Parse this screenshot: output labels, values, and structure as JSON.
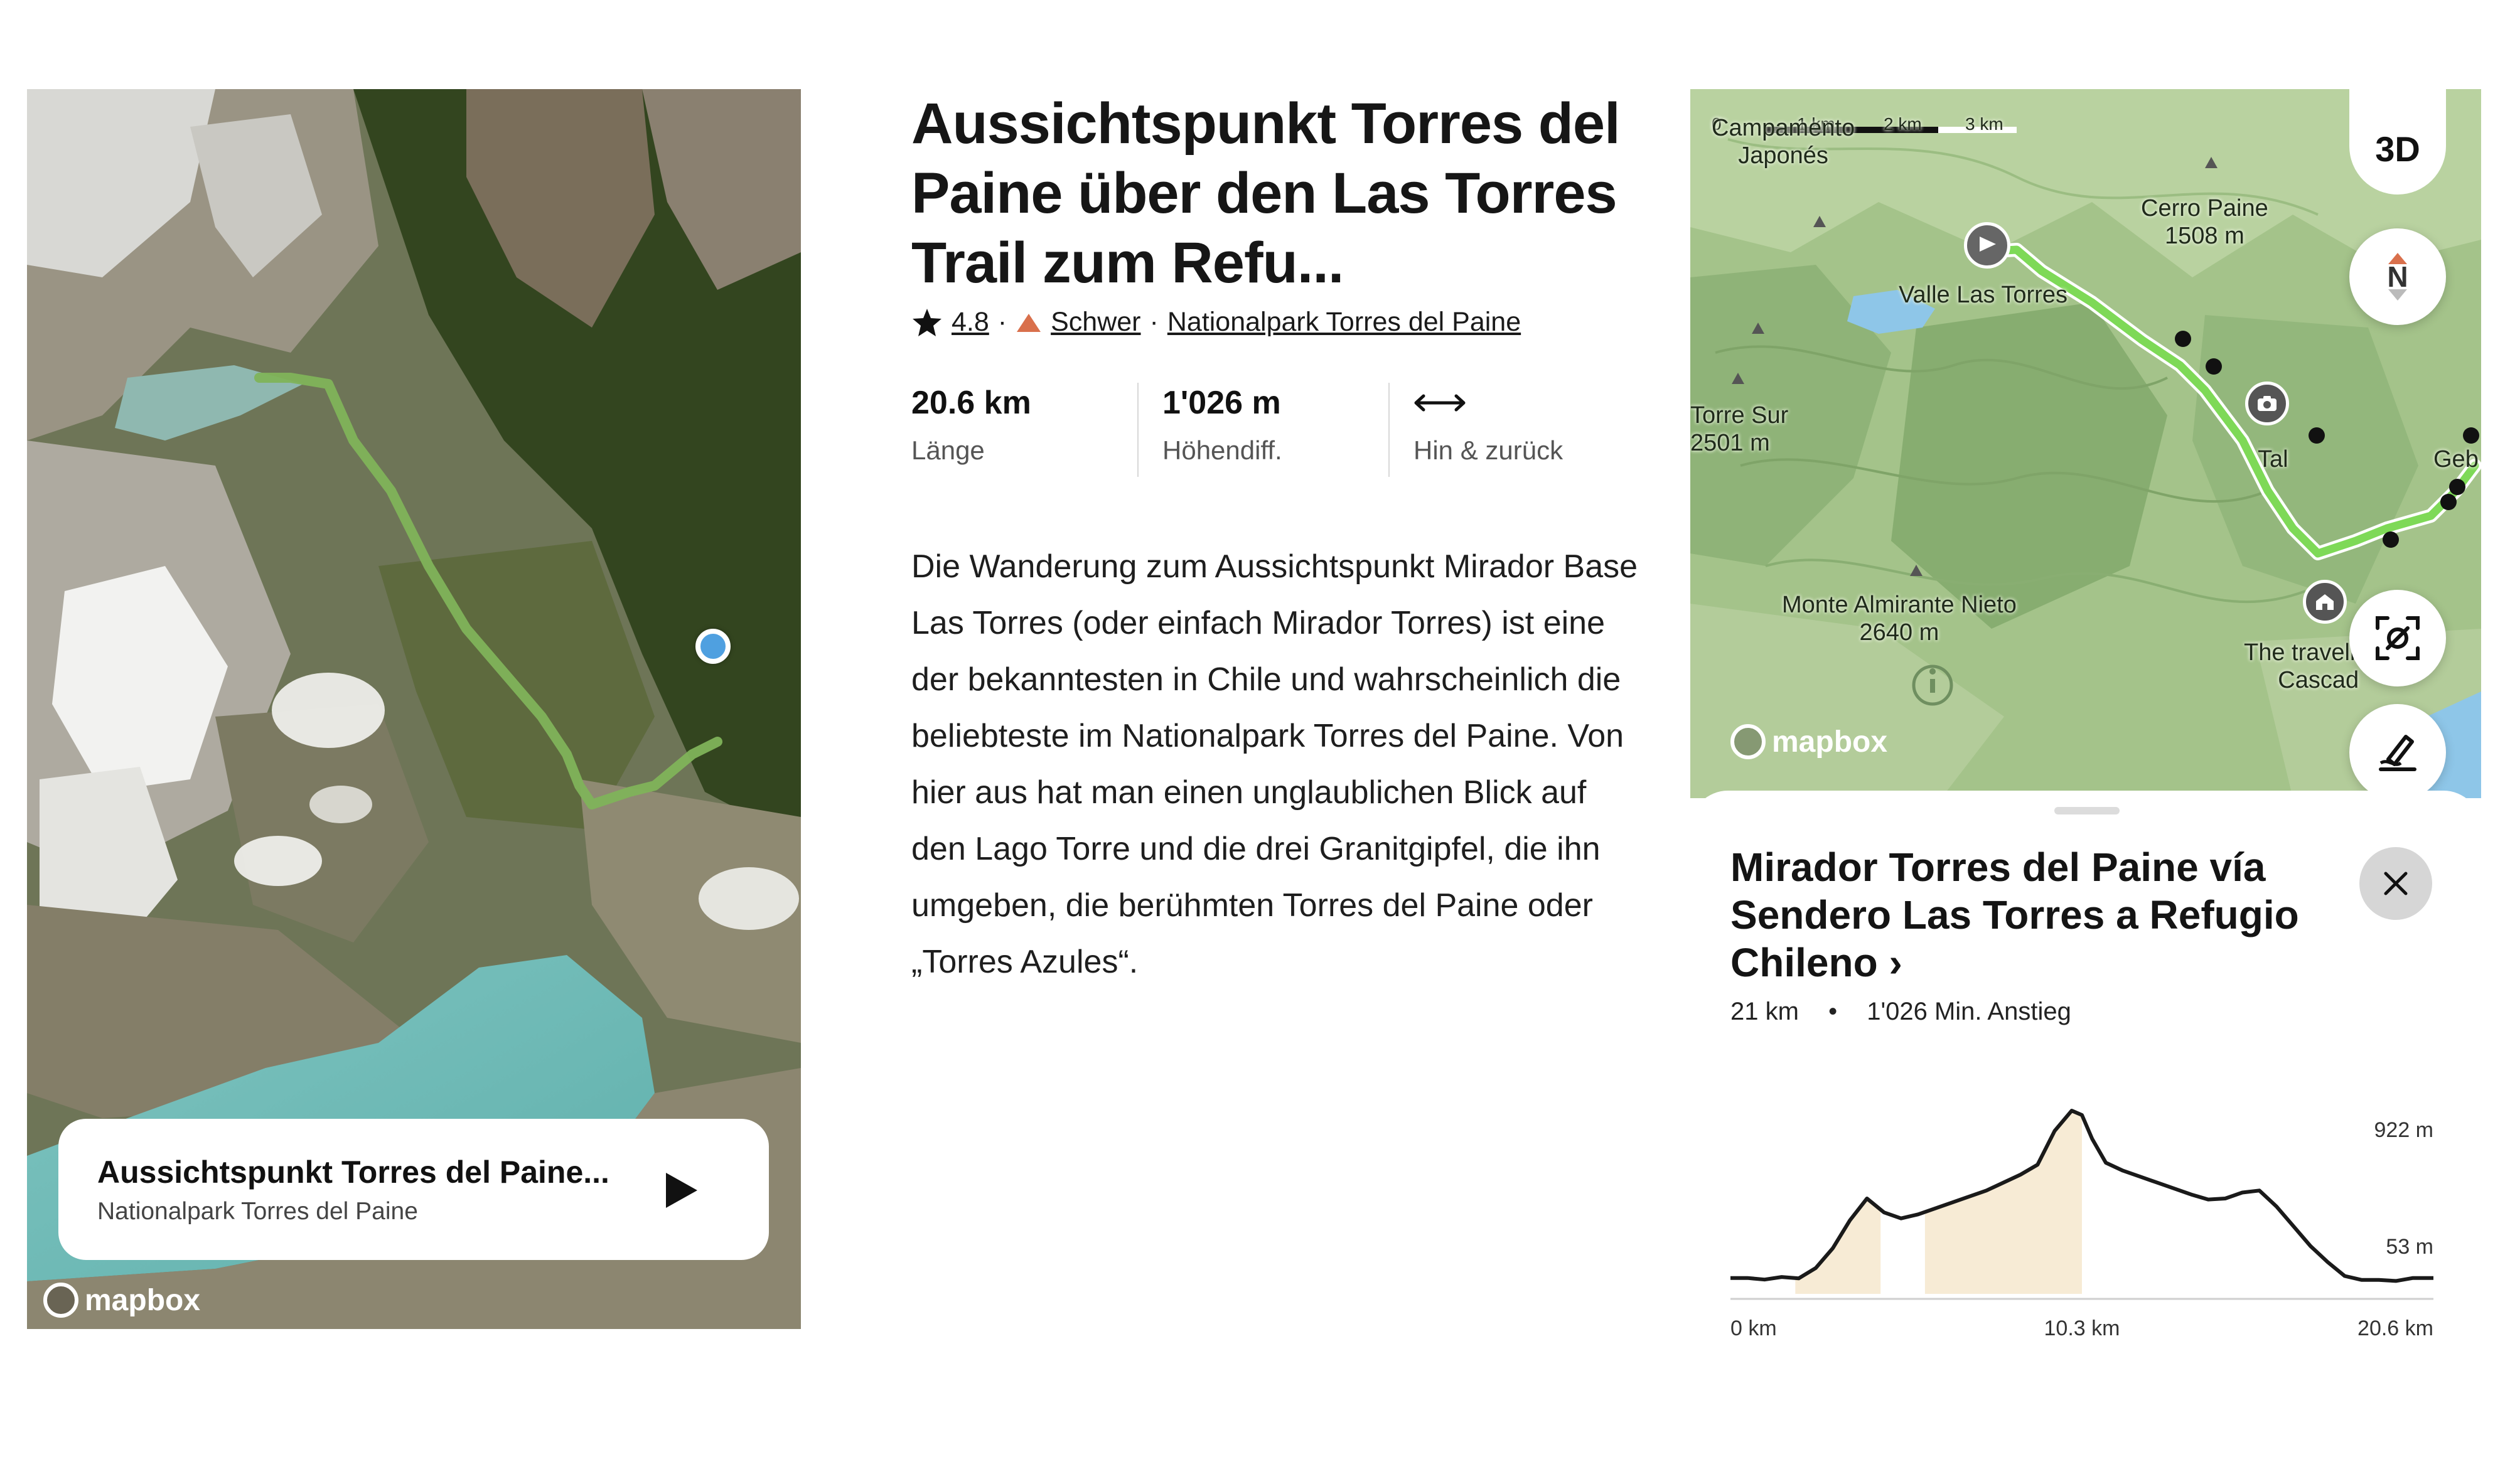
{
  "left_map": {
    "card_title": "Aussichtspunkt Torres del Paine...",
    "card_subtitle": "Nationalpark Torres del Paine",
    "logo": "mapbox",
    "play_icon": "play-icon"
  },
  "trail": {
    "title": "Aussichtspunkt Torres del Paine über den Las Torres Trail zum Refu...",
    "rating": "4.8",
    "difficulty": "Schwer",
    "park": "Nationalpark Torres del Paine",
    "difficulty_color": "#d9704c",
    "stats": [
      {
        "value": "20.6 km",
        "label": "Länge"
      },
      {
        "value": "1'026 m",
        "label": "Höhendiff."
      },
      {
        "icon": "two-way-arrow-icon",
        "label": "Hin & zurück"
      }
    ],
    "description": "Die Wanderung zum Aussichtspunkt Mirador Base Las Torres (oder einfach Mirador Torres) ist eine der bekanntesten in Chile und wahrscheinlich die beliebteste im Nationalpark Torres del Paine. Von hier aus hat man einen unglaublichen Blick auf den Lago Torre und die drei Granitgipfel, die ihn umgeben, die berühmten Torres del Paine oder „Torres Azules“."
  },
  "right_map": {
    "scale": [
      "0",
      "1 km",
      "2 km",
      "3 km"
    ],
    "labels": {
      "campamento": "Campamento\nJaponés",
      "cerro_paine": "Cerro Paine\n1508 m",
      "valle": "Valle Las Torres",
      "torre_sur": "Torre Sur\n2501 m",
      "tal": "Tal",
      "geb": "Geb",
      "almirante": "Monte Almirante Nieto\n2640 m",
      "traveller": "The traveller's\nCascad"
    },
    "btn_3d": "3D",
    "compass": "N",
    "logo": "mapbox",
    "route_color": "#7ed957"
  },
  "sheet": {
    "route_title": "Mirador Torres del Paine vía Sendero Las Torres a Refugio Chileno ›",
    "distance": "21 km",
    "separator": "•",
    "ascent": "1'026 Min. Anstieg"
  },
  "chart_data": {
    "type": "area",
    "x": [
      0,
      0.5,
      1,
      1.5,
      2,
      2.5,
      3,
      3.5,
      4,
      4.5,
      5,
      5.5,
      6,
      6.5,
      7,
      7.5,
      8,
      8.5,
      9,
      9.5,
      10,
      10.3,
      10.6,
      11,
      11.5,
      12,
      12.5,
      13,
      13.5,
      14,
      14.5,
      15,
      15.5,
      16,
      16.5,
      17,
      17.5,
      18,
      18.5,
      19,
      19.5,
      20,
      20.6
    ],
    "series": [
      {
        "values": [
          80,
          80,
          72,
          85,
          78,
          130,
          230,
          370,
          480,
          410,
          380,
          400,
          430,
          460,
          490,
          520,
          560,
          600,
          650,
          820,
          922,
          900,
          780,
          660,
          620,
          590,
          560,
          530,
          500,
          475,
          480,
          510,
          520,
          440,
          340,
          240,
          160,
          90,
          70,
          70,
          65,
          80,
          80
        ]
      }
    ],
    "xticks": [
      "0 km",
      "10.3 km",
      "20.6 km"
    ],
    "yticks": [
      "922 m",
      "53 m"
    ],
    "xlim": [
      0,
      20.6
    ],
    "ylim": [
      53,
      922
    ],
    "climb_segments_km": [
      [
        1.9,
        4.4
      ],
      [
        5.7,
        10.3
      ]
    ],
    "line_color": "#1a1a1a",
    "fill_color": "#f7ebd5"
  }
}
